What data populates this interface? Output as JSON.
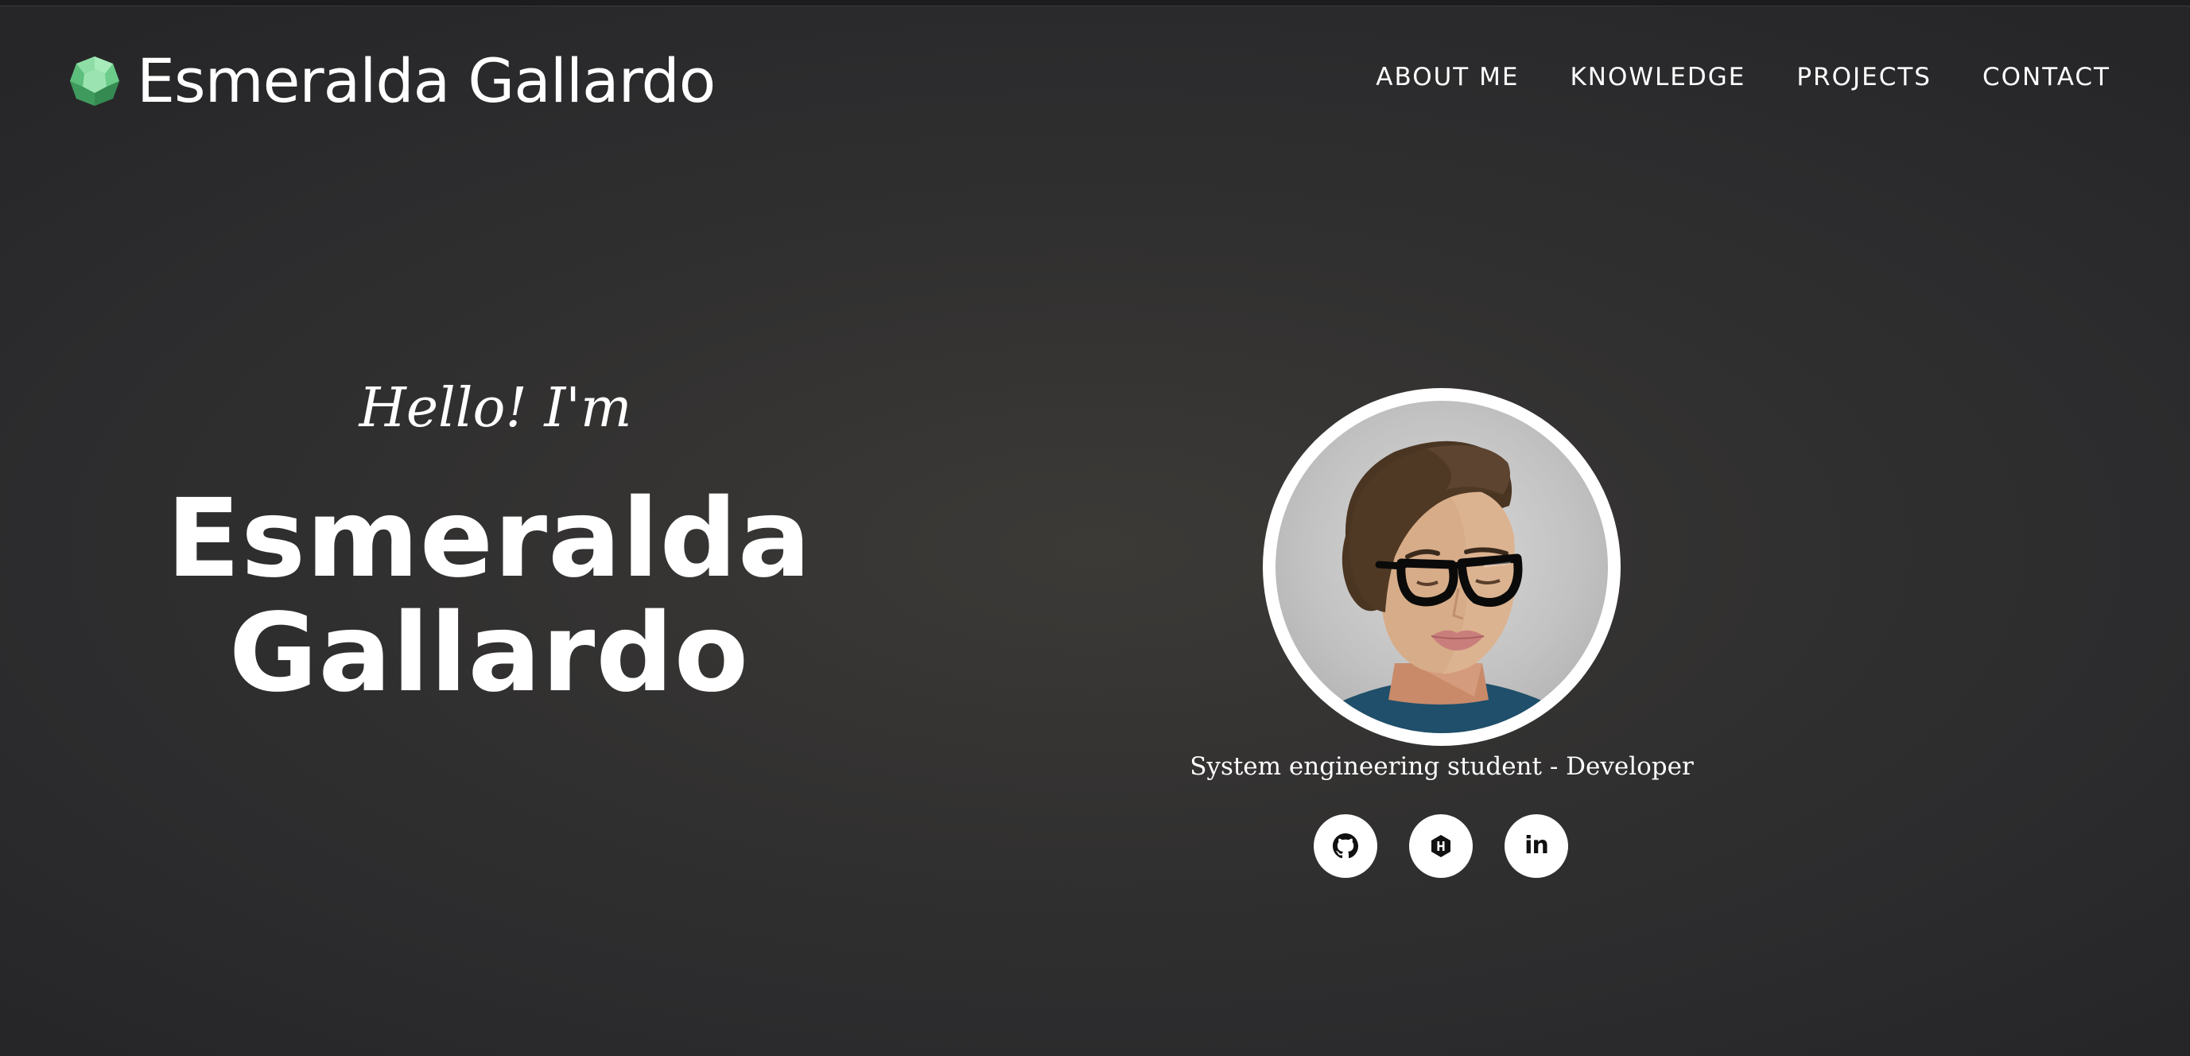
{
  "header": {
    "brand_name": "Esmeralda Gallardo",
    "logo_icon": "emerald-gem-icon",
    "nav": [
      {
        "label": "ABOUT ME"
      },
      {
        "label": "KNOWLEDGE"
      },
      {
        "label": "PROJECTS"
      },
      {
        "label": "CONTACT"
      }
    ]
  },
  "hero": {
    "greeting": "Hello! I'm",
    "name_line1": "Esmeralda",
    "name_line2": "Gallardo",
    "avatar_icon": "avatar-illustration",
    "tagline": "System engineering student - Developer",
    "socials": [
      {
        "icon": "github-icon"
      },
      {
        "icon": "hackerrank-icon"
      },
      {
        "icon": "linkedin-icon",
        "text": "in"
      }
    ]
  },
  "colors": {
    "background": "#2e2d2e",
    "text": "#ffffff",
    "gem_green": "#7fd89a",
    "social_bg": "#ffffff"
  }
}
